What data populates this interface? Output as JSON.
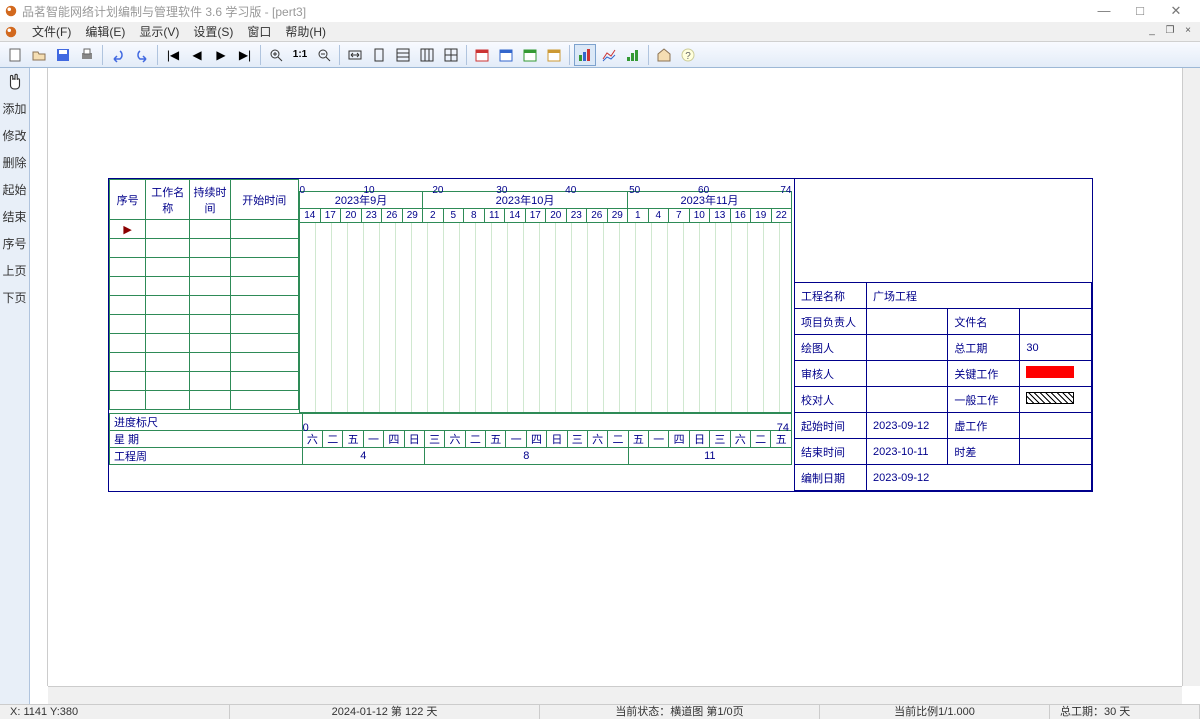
{
  "window": {
    "title": "品茗智能网络计划编制与管理软件 3.6 学习版 - [pert3]"
  },
  "menu": {
    "file": "文件(F)",
    "edit": "编辑(E)",
    "view": "显示(V)",
    "settings": "设置(S)",
    "window": "窗口",
    "help": "帮助(H)"
  },
  "sidebar": {
    "add": "添加",
    "modify": "修改",
    "delete": "删除",
    "start": "起始",
    "end": "结束",
    "seq": "序号",
    "prev": "上页",
    "next": "下页"
  },
  "grid": {
    "headers": {
      "seq": "序号",
      "name": "工作名称",
      "duration": "持续时间",
      "start": "开始时间"
    },
    "scale_top": [
      "0",
      "10",
      "20",
      "30",
      "40",
      "50",
      "60",
      "74"
    ],
    "months": [
      "2023年9月",
      "2023年10月",
      "2023年11月"
    ],
    "days": [
      "14",
      "17",
      "20",
      "23",
      "26",
      "29",
      "2",
      "5",
      "8",
      "11",
      "14",
      "17",
      "20",
      "23",
      "26",
      "29",
      "1",
      "4",
      "7",
      "10",
      "13",
      "16",
      "19",
      "22"
    ],
    "progress_label": "进度标尺",
    "week_label": "星 期",
    "week_vals": [
      "六",
      "二",
      "五",
      "一",
      "四",
      "日",
      "三",
      "六",
      "二",
      "五",
      "一",
      "四",
      "日",
      "三",
      "六",
      "二",
      "五",
      "一",
      "四",
      "日",
      "三",
      "六",
      "二",
      "五"
    ],
    "eng_week_label": "工程周",
    "eng_weeks": [
      "4",
      "8",
      "11"
    ],
    "scale_bottom_start": "0",
    "scale_bottom_end": "74"
  },
  "info": {
    "proj_name_lbl": "工程名称",
    "proj_name_val": "广场工程",
    "pm_lbl": "项目负责人",
    "pm_val": "",
    "file_lbl": "文件名",
    "file_val": "",
    "drawer_lbl": "绘图人",
    "drawer_val": "",
    "total_lbl": "总工期",
    "total_val": "30",
    "reviewer_lbl": "审核人",
    "reviewer_val": "",
    "critical_lbl": "关键工作",
    "checker_lbl": "校对人",
    "checker_val": "",
    "normal_lbl": "一般工作",
    "start_lbl": "起始时间",
    "start_val": "2023-09-12",
    "dummy_lbl": "虚工作",
    "end_lbl": "结束时间",
    "end_val": "2023-10-11",
    "float_lbl": "时差",
    "made_lbl": "编制日期",
    "made_val": "2023-09-12"
  },
  "status": {
    "coords": "X: 1141  Y:380",
    "date": "2024-01-12 第 122 天",
    "state": "当前状态：横道图 第1/0页",
    "scale": "当前比例1/1.000",
    "total": "总工期：30 天"
  }
}
